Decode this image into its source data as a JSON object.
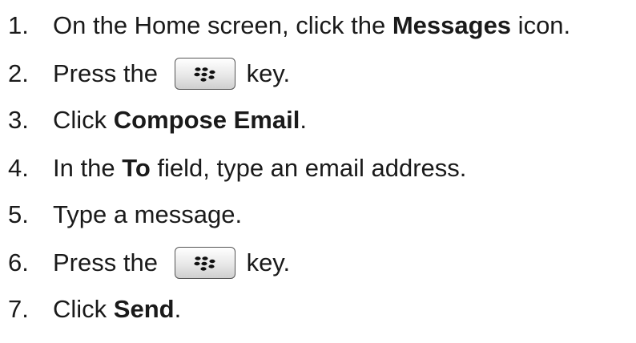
{
  "steps": [
    {
      "num": "1.",
      "pre": "On the Home screen, click the ",
      "bold": "Messages",
      "post": " icon."
    },
    {
      "num": "2.",
      "pre": "Press the ",
      "key_icon": "blackberry-menu-key-icon",
      "post": "key."
    },
    {
      "num": "3.",
      "pre": "Click ",
      "bold": "Compose Email",
      "post": "."
    },
    {
      "num": "4.",
      "pre": "In the ",
      "bold": "To",
      "post": " field, type an email address."
    },
    {
      "num": "5.",
      "pre": "Type a message."
    },
    {
      "num": "6.",
      "pre": "Press the ",
      "key_icon": "blackberry-menu-key-icon",
      "post": "key."
    },
    {
      "num": "7.",
      "pre": "Click ",
      "bold": "Send",
      "post": "."
    }
  ]
}
